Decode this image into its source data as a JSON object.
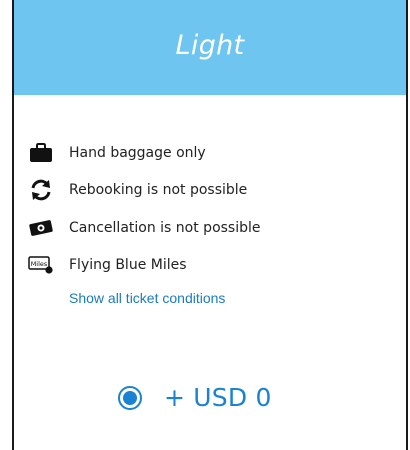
{
  "fare": {
    "title": "Light",
    "features": [
      {
        "icon": "hand-baggage-icon",
        "label": "Hand baggage only"
      },
      {
        "icon": "rebooking-icon",
        "label": "Rebooking is not possible"
      },
      {
        "icon": "cancellation-icon",
        "label": "Cancellation is not possible"
      },
      {
        "icon": "miles-icon",
        "icon_text": "Miles",
        "label": "Flying Blue Miles"
      }
    ],
    "conditions_link": "Show all ticket conditions",
    "price": "+ USD 0",
    "selected": true
  },
  "colors": {
    "header": "#6ec5f0",
    "accent": "#1a82d0",
    "link": "#1a7bc4",
    "text": "#222222"
  }
}
